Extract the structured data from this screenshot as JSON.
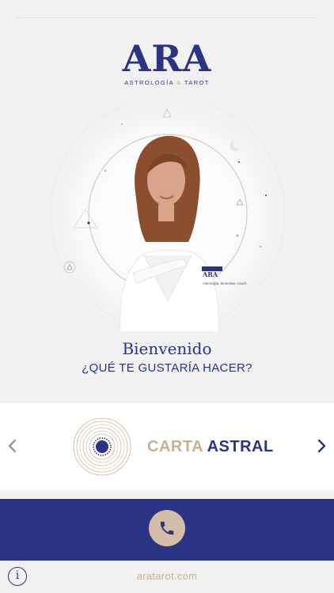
{
  "brand": {
    "name": "ARA",
    "tagline_left": "ASTROLOGÍA",
    "tagline_amp": "&",
    "tagline_right": "TAROT",
    "badge_name": "ARA",
    "badge_tagline": "Astrología, bienestar, coach."
  },
  "welcome": {
    "title": "Bienvenido",
    "question": "¿QUÉ TE GUSTARÍA HACER?"
  },
  "carousel": {
    "prev_icon": "chevron-left-icon",
    "next_icon": "chevron-right-icon",
    "slide": {
      "word1": "CARTA",
      "word2": "ASTRAL",
      "icon": "astral-chart-disc-icon"
    }
  },
  "call": {
    "icon": "phone-icon"
  },
  "footer": {
    "info_label": "i",
    "website": "aratarot.com"
  },
  "colors": {
    "navy": "#2b3483",
    "gold": "#c9b091",
    "background": "#f2f1f1",
    "call_button": "#d3bda6"
  }
}
